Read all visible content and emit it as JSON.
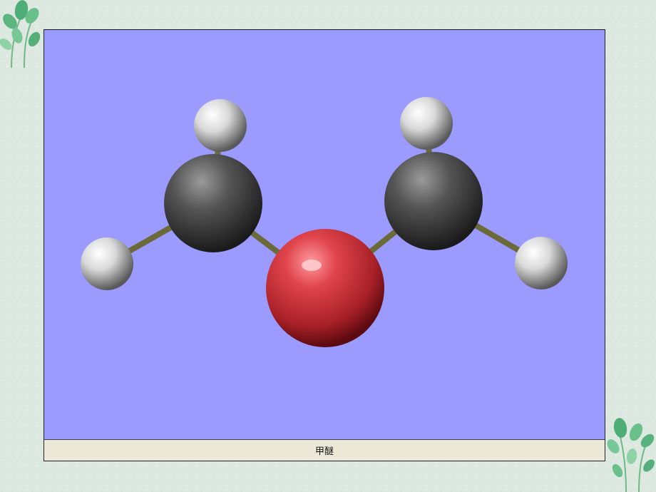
{
  "viewer": {
    "caption": "甲醚",
    "background_color": "#9b9bff",
    "caption_bar_color": "#ece9d8"
  },
  "slide": {
    "background_color": "#dde9e0",
    "decoration_icon": "leaf-sprout-icon"
  },
  "molecule": {
    "atom_colors": {
      "hydrogen": "#e6e6e6",
      "carbon": "#4a4a4a",
      "oxygen": "#d8404a"
    },
    "bond_color": "#6b6b3a"
  }
}
